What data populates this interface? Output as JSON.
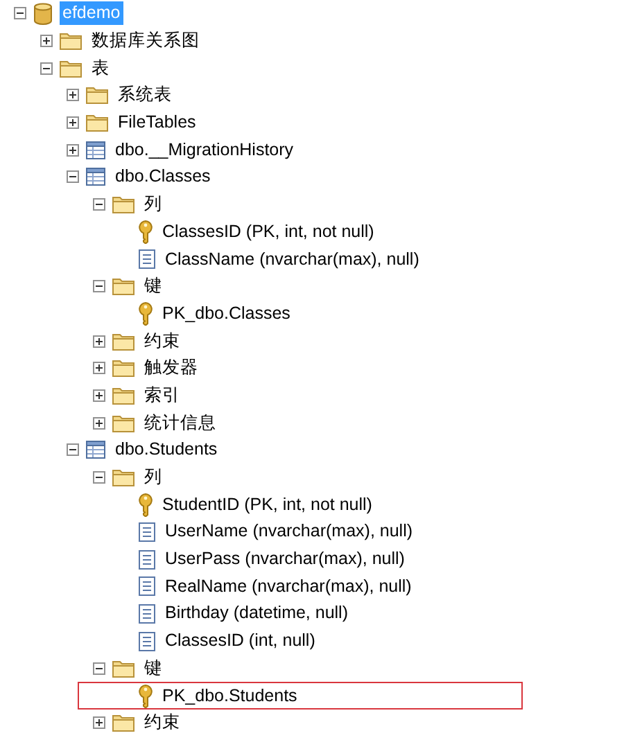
{
  "tree": [
    {
      "label": "efdemo",
      "kind": "database",
      "expanded": true,
      "selected": true,
      "marked": false,
      "children": [
        {
          "label": "数据库关系图",
          "kind": "folder",
          "expanded": false,
          "selected": false,
          "marked": false
        },
        {
          "label": "表",
          "kind": "folder",
          "expanded": true,
          "selected": false,
          "marked": false,
          "children": [
            {
              "label": "系统表",
              "kind": "folder",
              "expanded": false,
              "selected": false,
              "marked": false
            },
            {
              "label": "FileTables",
              "kind": "folder",
              "expanded": false,
              "selected": false,
              "marked": false
            },
            {
              "label": "dbo.__MigrationHistory",
              "kind": "table",
              "expanded": false,
              "selected": false,
              "marked": false
            },
            {
              "label": "dbo.Classes",
              "kind": "table",
              "expanded": true,
              "selected": false,
              "marked": false,
              "children": [
                {
                  "label": "列",
                  "kind": "folder",
                  "expanded": true,
                  "selected": false,
                  "marked": false,
                  "children": [
                    {
                      "label": "ClassesID (PK, int, not null)",
                      "kind": "key",
                      "selected": false,
                      "marked": false
                    },
                    {
                      "label": "ClassName (nvarchar(max), null)",
                      "kind": "column",
                      "selected": false,
                      "marked": false
                    }
                  ]
                },
                {
                  "label": "键",
                  "kind": "folder",
                  "expanded": true,
                  "selected": false,
                  "marked": false,
                  "children": [
                    {
                      "label": "PK_dbo.Classes",
                      "kind": "key",
                      "selected": false,
                      "marked": false
                    }
                  ]
                },
                {
                  "label": "约束",
                  "kind": "folder",
                  "expanded": false,
                  "selected": false,
                  "marked": false
                },
                {
                  "label": "触发器",
                  "kind": "folder",
                  "expanded": false,
                  "selected": false,
                  "marked": false
                },
                {
                  "label": "索引",
                  "kind": "folder",
                  "expanded": false,
                  "selected": false,
                  "marked": false
                },
                {
                  "label": "统计信息",
                  "kind": "folder",
                  "expanded": false,
                  "selected": false,
                  "marked": false
                }
              ]
            },
            {
              "label": "dbo.Students",
              "kind": "table",
              "expanded": true,
              "selected": false,
              "marked": false,
              "children": [
                {
                  "label": "列",
                  "kind": "folder",
                  "expanded": true,
                  "selected": false,
                  "marked": false,
                  "children": [
                    {
                      "label": "StudentID (PK, int, not null)",
                      "kind": "key",
                      "selected": false,
                      "marked": false
                    },
                    {
                      "label": "UserName (nvarchar(max), null)",
                      "kind": "column",
                      "selected": false,
                      "marked": false
                    },
                    {
                      "label": "UserPass (nvarchar(max), null)",
                      "kind": "column",
                      "selected": false,
                      "marked": false
                    },
                    {
                      "label": "RealName (nvarchar(max), null)",
                      "kind": "column",
                      "selected": false,
                      "marked": false
                    },
                    {
                      "label": "Birthday (datetime, null)",
                      "kind": "column",
                      "selected": false,
                      "marked": false
                    },
                    {
                      "label": "ClassesID (int, null)",
                      "kind": "column",
                      "selected": false,
                      "marked": false
                    }
                  ]
                },
                {
                  "label": "键",
                  "kind": "folder",
                  "expanded": true,
                  "selected": false,
                  "marked": false,
                  "children": [
                    {
                      "label": "PK_dbo.Students",
                      "kind": "key",
                      "selected": false,
                      "marked": true
                    }
                  ]
                },
                {
                  "label": "约束",
                  "kind": "folder",
                  "expanded": false,
                  "selected": false,
                  "marked": false
                }
              ]
            }
          ]
        }
      ]
    }
  ]
}
